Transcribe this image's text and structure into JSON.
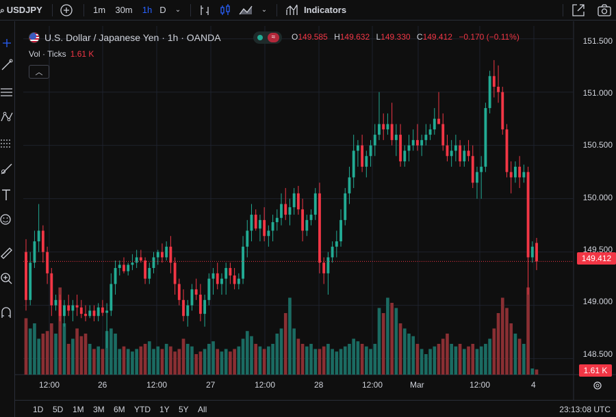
{
  "symbol": "USDJPY",
  "toolbar": {
    "intervals": [
      "1m",
      "30m",
      "1h",
      "D"
    ],
    "active_interval": "1h",
    "indicators_label": "Indicators"
  },
  "legend": {
    "title": "U.S. Dollar / Japanese Yen · 1h · OANDA",
    "ohlc": [
      {
        "k": "O",
        "v": "149.585"
      },
      {
        "k": "H",
        "v": "149.632"
      },
      {
        "k": "L",
        "v": "149.330"
      },
      {
        "k": "C",
        "v": "149.412"
      }
    ],
    "change": "−0.170 (−0.11%)",
    "vol_label": "Vol · Ticks",
    "vol_value": "1.61 K"
  },
  "price_axis": [
    "151.500",
    "151.000",
    "150.500",
    "150.000",
    "149.500",
    "149.000",
    "148.500"
  ],
  "current_price": "149.412",
  "current_volume": "1.61 K",
  "time_axis": [
    "12:00",
    "26",
    "12:00",
    "27",
    "12:00",
    "28",
    "12:00",
    "Mar",
    "12:00",
    "4"
  ],
  "ranges": [
    "1D",
    "5D",
    "1M",
    "3M",
    "6M",
    "YTD",
    "1Y",
    "5Y",
    "All"
  ],
  "clock": "23:13:08 UTC",
  "colors": {
    "up": "#22ab94",
    "down": "#f23645",
    "up_vol": "#1b6b62",
    "down_vol": "#8a2f33",
    "bg": "#0f0f0f"
  },
  "chart_data": {
    "type": "candlestick",
    "ylim": [
      148.35,
      151.62
    ],
    "candles": [
      [
        149.5,
        149.62,
        148.95,
        149.05,
        1.1
      ],
      [
        149.05,
        149.5,
        149.0,
        149.4,
        0.9
      ],
      [
        149.4,
        149.7,
        149.35,
        149.6,
        1.0
      ],
      [
        149.6,
        149.95,
        149.5,
        149.7,
        0.7
      ],
      [
        149.7,
        149.75,
        149.4,
        149.5,
        0.8
      ],
      [
        149.5,
        149.55,
        149.2,
        149.3,
        0.85
      ],
      [
        149.3,
        149.35,
        148.9,
        149.0,
        1.0
      ],
      [
        149.0,
        149.1,
        148.95,
        149.05,
        0.8
      ],
      [
        149.05,
        149.1,
        148.85,
        148.9,
        1.7
      ],
      [
        148.9,
        149.05,
        148.8,
        149.0,
        1.0
      ],
      [
        149.0,
        149.1,
        148.9,
        148.95,
        0.6
      ],
      [
        148.95,
        149.05,
        148.85,
        149.0,
        0.7
      ],
      [
        149.0,
        149.1,
        148.9,
        148.98,
        0.9
      ],
      [
        148.98,
        149.05,
        148.88,
        148.92,
        0.75
      ],
      [
        148.92,
        149.0,
        148.85,
        148.9,
        0.8
      ],
      [
        148.9,
        149.0,
        148.88,
        148.95,
        0.6
      ],
      [
        148.95,
        149.0,
        148.85,
        148.9,
        0.5
      ],
      [
        148.9,
        149.02,
        148.85,
        148.98,
        0.55
      ],
      [
        148.98,
        149.05,
        148.9,
        148.93,
        0.5
      ],
      [
        148.93,
        149.02,
        148.6,
        148.95,
        0.85
      ],
      [
        148.95,
        149.3,
        148.9,
        149.2,
        0.9
      ],
      [
        149.2,
        149.42,
        149.1,
        149.35,
        0.8
      ],
      [
        149.35,
        149.42,
        149.28,
        149.38,
        0.5
      ],
      [
        149.38,
        149.45,
        149.3,
        149.32,
        0.55
      ],
      [
        149.32,
        149.4,
        149.28,
        149.38,
        0.5
      ],
      [
        149.38,
        149.48,
        149.33,
        149.4,
        0.45
      ],
      [
        149.4,
        149.52,
        149.35,
        149.45,
        0.5
      ],
      [
        149.45,
        149.52,
        149.4,
        149.42,
        0.55
      ],
      [
        149.42,
        149.45,
        149.2,
        149.25,
        0.6
      ],
      [
        149.25,
        149.4,
        149.2,
        149.35,
        0.65
      ],
      [
        149.35,
        149.5,
        149.3,
        149.45,
        0.5
      ],
      [
        149.45,
        149.52,
        149.38,
        149.5,
        0.55
      ],
      [
        149.5,
        149.58,
        149.4,
        149.45,
        0.5
      ],
      [
        149.45,
        149.6,
        149.42,
        149.55,
        0.6
      ],
      [
        149.55,
        149.65,
        149.3,
        149.4,
        0.55
      ],
      [
        149.4,
        149.45,
        149.1,
        149.2,
        0.45
      ],
      [
        149.2,
        149.25,
        149.0,
        149.05,
        0.5
      ],
      [
        149.05,
        149.15,
        148.85,
        148.9,
        0.7
      ],
      [
        148.9,
        149.05,
        148.8,
        149.0,
        0.6
      ],
      [
        149.0,
        149.2,
        148.95,
        149.15,
        0.55
      ],
      [
        149.15,
        149.25,
        149.05,
        149.1,
        0.4
      ],
      [
        149.1,
        149.2,
        148.85,
        148.92,
        0.45
      ],
      [
        148.92,
        149.1,
        148.8,
        149.05,
        0.5
      ],
      [
        149.05,
        149.3,
        149.0,
        149.25,
        0.6
      ],
      [
        149.25,
        149.35,
        149.1,
        149.3,
        0.65
      ],
      [
        149.3,
        149.4,
        149.15,
        149.2,
        0.5
      ],
      [
        149.2,
        149.3,
        149.1,
        149.25,
        0.45
      ],
      [
        149.25,
        149.4,
        149.1,
        149.35,
        0.5
      ],
      [
        149.35,
        149.4,
        149.2,
        149.28,
        0.45
      ],
      [
        149.28,
        149.35,
        149.15,
        149.2,
        0.5
      ],
      [
        149.2,
        149.3,
        149.15,
        149.25,
        0.55
      ],
      [
        149.25,
        149.65,
        149.2,
        149.55,
        0.7
      ],
      [
        149.55,
        149.8,
        149.45,
        149.7,
        0.85
      ],
      [
        149.7,
        149.95,
        149.6,
        149.85,
        0.75
      ],
      [
        149.85,
        149.9,
        149.7,
        149.72,
        0.6
      ],
      [
        149.72,
        149.85,
        149.6,
        149.8,
        0.55
      ],
      [
        149.8,
        149.92,
        149.6,
        149.65,
        0.5
      ],
      [
        149.65,
        149.75,
        149.55,
        149.7,
        0.55
      ],
      [
        149.7,
        149.85,
        149.6,
        149.78,
        0.6
      ],
      [
        149.78,
        149.9,
        149.7,
        149.82,
        0.8
      ],
      [
        149.82,
        150.05,
        149.75,
        149.95,
        0.9
      ],
      [
        149.95,
        150.1,
        149.8,
        149.85,
        1.2
      ],
      [
        149.85,
        150.0,
        149.75,
        149.92,
        1.5
      ],
      [
        149.92,
        150.1,
        149.85,
        150.05,
        0.9
      ],
      [
        150.05,
        150.12,
        149.85,
        149.9,
        0.7
      ],
      [
        149.9,
        150.0,
        149.6,
        149.7,
        0.6
      ],
      [
        149.7,
        149.85,
        149.65,
        149.8,
        0.55
      ],
      [
        149.8,
        149.9,
        149.75,
        149.85,
        0.6
      ],
      [
        149.85,
        150.1,
        149.8,
        150.05,
        0.5
      ],
      [
        150.05,
        150.15,
        149.3,
        149.4,
        0.5
      ],
      [
        149.4,
        149.45,
        149.2,
        149.3,
        0.55
      ],
      [
        149.3,
        149.5,
        149.1,
        149.45,
        0.6
      ],
      [
        149.45,
        149.6,
        149.4,
        149.55,
        0.5
      ],
      [
        149.55,
        149.7,
        149.45,
        149.6,
        0.45
      ],
      [
        149.6,
        149.9,
        149.55,
        149.8,
        0.5
      ],
      [
        149.8,
        150.1,
        149.75,
        150.05,
        0.55
      ],
      [
        150.05,
        150.3,
        149.95,
        150.2,
        0.6
      ],
      [
        150.2,
        150.6,
        150.1,
        150.45,
        0.7
      ],
      [
        150.45,
        150.55,
        150.3,
        150.5,
        0.65
      ],
      [
        150.5,
        150.6,
        150.25,
        150.3,
        0.6
      ],
      [
        150.3,
        150.45,
        150.2,
        150.4,
        0.55
      ],
      [
        150.4,
        150.55,
        150.3,
        150.5,
        0.5
      ],
      [
        150.5,
        150.7,
        150.4,
        150.6,
        0.6
      ],
      [
        150.6,
        151.0,
        150.55,
        150.7,
        1.3
      ],
      [
        150.7,
        150.8,
        150.55,
        150.65,
        1.2
      ],
      [
        150.65,
        150.8,
        150.6,
        150.7,
        1.5
      ],
      [
        150.7,
        150.9,
        150.5,
        150.55,
        1.4
      ],
      [
        150.55,
        150.7,
        150.4,
        150.6,
        1.3
      ],
      [
        150.6,
        150.7,
        150.3,
        150.35,
        1.0
      ],
      [
        150.35,
        150.5,
        150.3,
        150.45,
        0.9
      ],
      [
        150.45,
        150.6,
        150.35,
        150.5,
        0.8
      ],
      [
        150.5,
        150.65,
        150.45,
        150.55,
        0.75
      ],
      [
        150.55,
        150.7,
        150.45,
        150.5,
        0.6
      ],
      [
        150.5,
        150.6,
        150.4,
        150.55,
        0.5
      ],
      [
        150.55,
        150.7,
        150.5,
        150.6,
        0.4
      ],
      [
        150.6,
        150.7,
        150.55,
        150.65,
        0.5
      ],
      [
        150.65,
        150.85,
        150.6,
        150.75,
        0.55
      ],
      [
        150.75,
        151.0,
        150.7,
        150.7,
        0.6
      ],
      [
        150.7,
        150.8,
        150.45,
        150.5,
        0.7
      ],
      [
        150.5,
        150.6,
        150.35,
        150.4,
        0.8
      ],
      [
        150.4,
        150.55,
        150.3,
        150.45,
        0.6
      ],
      [
        150.45,
        150.6,
        150.35,
        150.5,
        0.55
      ],
      [
        150.5,
        150.55,
        150.3,
        150.35,
        0.6
      ],
      [
        150.35,
        150.5,
        150.3,
        150.45,
        0.5
      ],
      [
        150.45,
        150.55,
        150.35,
        150.4,
        0.55
      ],
      [
        150.4,
        150.5,
        150.1,
        150.15,
        0.6
      ],
      [
        150.15,
        150.3,
        150.0,
        150.25,
        0.5
      ],
      [
        150.25,
        150.4,
        150.0,
        150.3,
        0.55
      ],
      [
        150.3,
        150.9,
        150.25,
        150.85,
        0.6
      ],
      [
        150.85,
        151.2,
        150.8,
        151.15,
        0.7
      ],
      [
        151.15,
        151.3,
        150.95,
        151.05,
        0.9
      ],
      [
        151.05,
        151.25,
        150.9,
        151.0,
        1.2
      ],
      [
        151.0,
        151.05,
        150.6,
        150.65,
        1.5
      ],
      [
        150.65,
        150.7,
        150.2,
        150.25,
        1.3
      ],
      [
        150.25,
        150.35,
        150.05,
        150.2,
        1.0
      ],
      [
        150.2,
        150.35,
        150.15,
        150.3,
        0.8
      ],
      [
        150.3,
        150.4,
        150.1,
        150.2,
        0.7
      ],
      [
        150.2,
        150.32,
        150.15,
        150.25,
        0.6
      ],
      [
        150.25,
        150.3,
        149.1,
        149.45,
        1.7
      ],
      [
        149.45,
        149.6,
        149.4,
        149.55,
        0.12
      ],
      [
        149.585,
        149.632,
        149.33,
        149.412,
        0.1
      ]
    ]
  }
}
